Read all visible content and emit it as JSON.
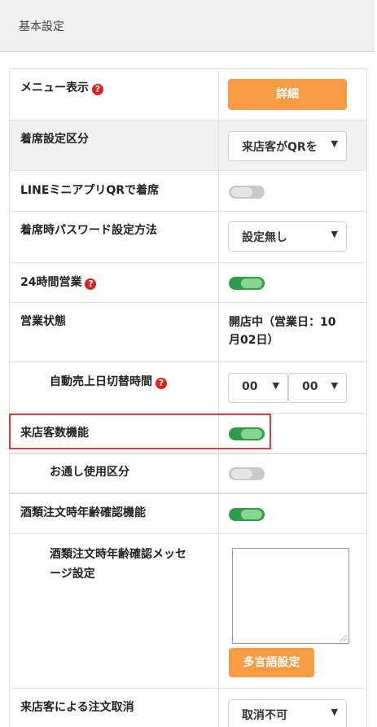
{
  "section": {
    "title": "基本設定"
  },
  "rows": {
    "menu_display": {
      "label": "メニュー表示",
      "button": "詳細"
    },
    "seating_category": {
      "label": "着席設定区分",
      "value": "来店客がQRを"
    },
    "line_mini_app": {
      "label": "LINEミニアプリQRで着席",
      "toggle": false
    },
    "seating_password": {
      "label": "着席時パスワード設定方法",
      "value": "設定無し"
    },
    "open_24h": {
      "label": "24時間営業",
      "toggle": true
    },
    "business_status": {
      "label": "営業状態",
      "line1": "開店中（営業日：10",
      "line2": "月02日）"
    },
    "auto_switch": {
      "label": "自動売上日切替時間",
      "hour": "00",
      "minute": "00"
    },
    "visitor_count": {
      "label": "来店客数機能",
      "toggle": true
    },
    "otoshi": {
      "label": "お通し使用区分",
      "toggle": false
    },
    "alcohol_age": {
      "label": "酒類注文時年齢確認機能",
      "toggle": true
    },
    "alcohol_message": {
      "label_line1": "酒類注文時年齢確認メッセ",
      "label_line2": "ージ設定",
      "textarea": "",
      "button": "多言語設定"
    },
    "order_cancel": {
      "label": "来店客による注文取消",
      "value": "取消不可"
    }
  },
  "colors": {
    "accent": "#f79b45",
    "toggle_on": "#2e9d4a",
    "toggle_off": "#c9c9c9",
    "help": "#e02020",
    "highlight": "#e23b3b"
  }
}
